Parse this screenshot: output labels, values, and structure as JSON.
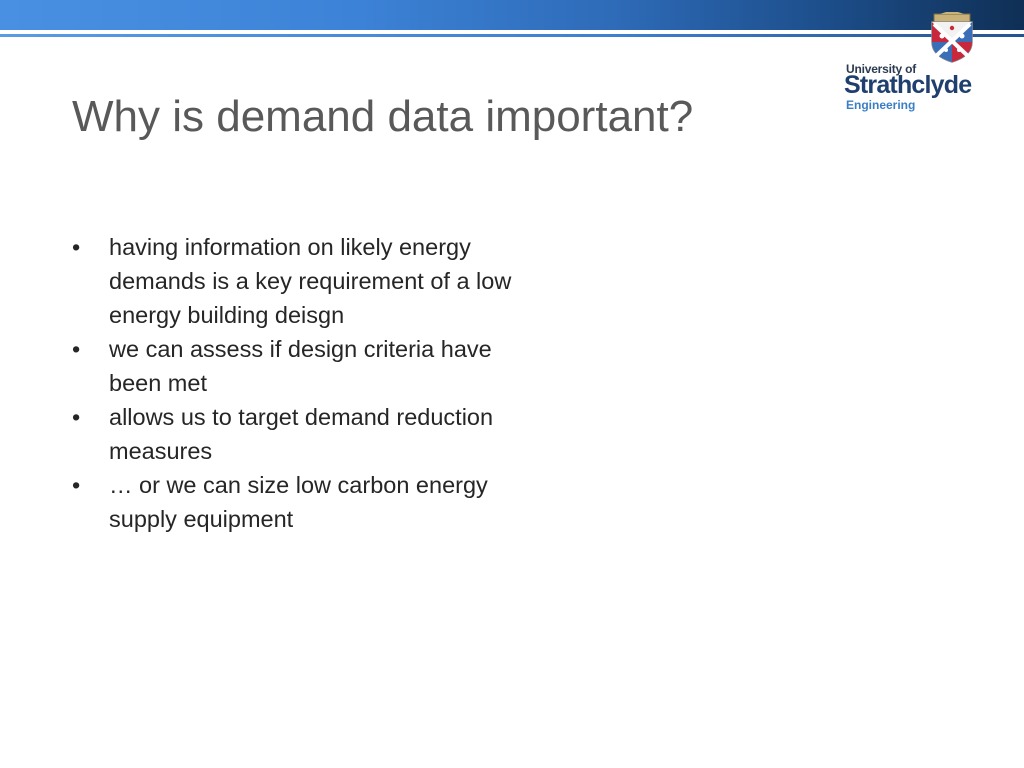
{
  "header": {
    "logo": {
      "university_of": "University of",
      "strathclyde": "Strathclyde",
      "engineering": "Engineering",
      "crest_icon": "strathclyde-crest"
    },
    "band_colors": [
      "#4a90e2",
      "#1d4f8c",
      "#0f2f55"
    ]
  },
  "slide": {
    "title": "Why is demand data important?",
    "bullet_symbol": "•",
    "bullets": [
      {
        "text": "having information on likely energy demands is a key requirement of a low energy building deisgn"
      },
      {
        "text": "we can assess if design criteria have been met"
      },
      {
        "text": "allows us to target demand reduction measures"
      },
      {
        "text": "… or we can size low carbon energy supply equipment"
      }
    ]
  }
}
